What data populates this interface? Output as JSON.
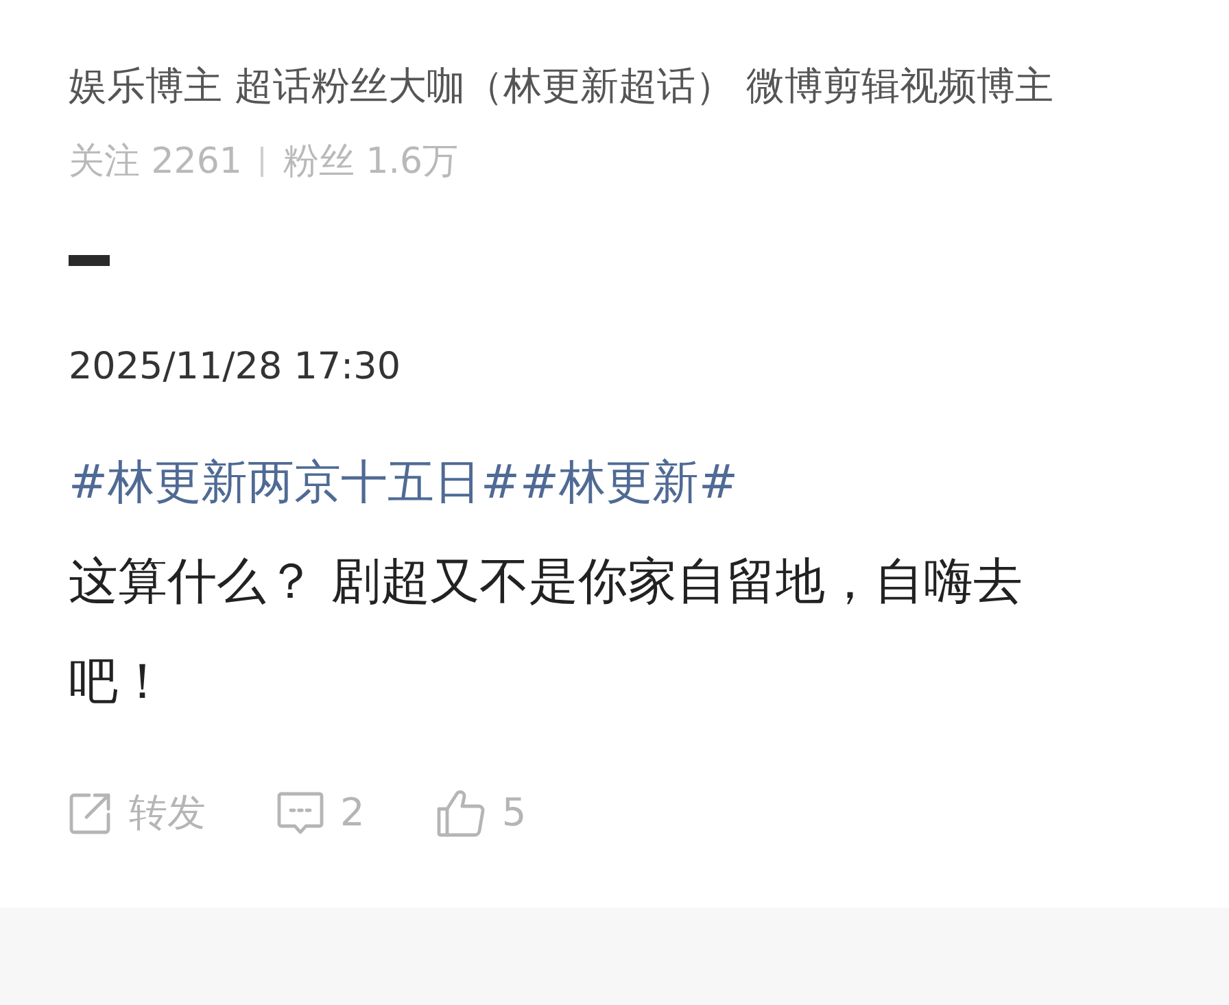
{
  "profile": {
    "bio": "娱乐博主 超话粉丝大咖（林更新超话） 微博剪辑视频博主",
    "stats": [
      {
        "label": "关注 2261"
      },
      {
        "label": "粉丝 1.6万"
      }
    ]
  },
  "post": {
    "timestamp": "2025/11/28 17:30",
    "hashtags": [
      "#林更新两京十五日#",
      "#林更新#"
    ],
    "text": "这算什么？ 剧超又不是你家自留地，自嗨去吧！"
  },
  "actions": [
    {
      "kind": "repost",
      "label": "转发"
    },
    {
      "kind": "comment",
      "label": "2"
    },
    {
      "kind": "like",
      "label": "5"
    }
  ]
}
